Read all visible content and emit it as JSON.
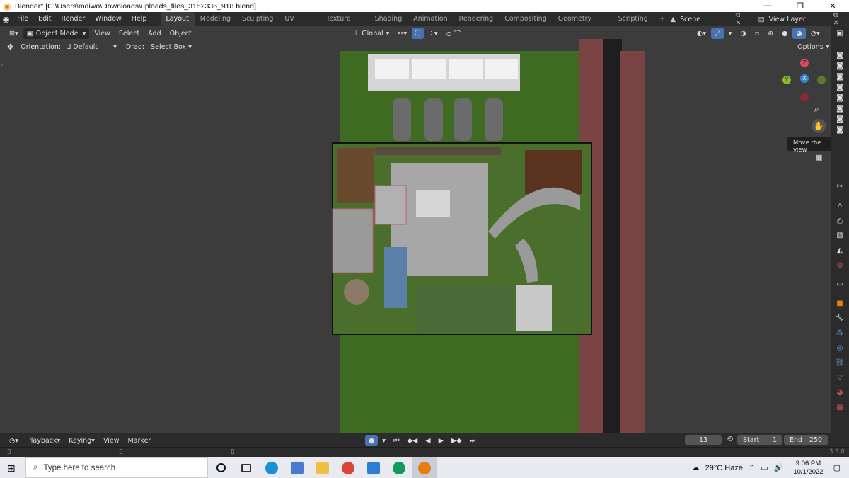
{
  "window": {
    "title": "Blender* [C:\\Users\\mdiwo\\Downloads\\uploads_files_3152336_918.blend]",
    "minimize": "—",
    "maximize": "❐",
    "close": "✕"
  },
  "menu": [
    "File",
    "Edit",
    "Render",
    "Window",
    "Help"
  ],
  "workspaces": [
    "Layout",
    "Modeling",
    "Sculpting",
    "UV Editing",
    "Texture Paint",
    "Shading",
    "Animation",
    "Rendering",
    "Compositing",
    "Geometry Nodes",
    "Scripting"
  ],
  "scene": {
    "label": "Scene",
    "view_layer": "View Layer"
  },
  "viewport_header": {
    "mode": "Object Mode",
    "menus": [
      "View",
      "Select",
      "Add",
      "Object"
    ],
    "transform": "Global"
  },
  "tool_header": {
    "orientation_label": "Orientation:",
    "orientation_value": "Default",
    "drag_label": "Drag:",
    "drag_value": "Select Box",
    "options": "Options"
  },
  "gizmo": {
    "x": "X",
    "y": "Y",
    "z": "Z"
  },
  "tooltip": "Move the view",
  "timeline": {
    "menus": [
      "Playback",
      "Keying",
      "View",
      "Marker"
    ],
    "current_frame": "13",
    "start_label": "Start",
    "start_value": "1",
    "end_label": "End",
    "end_value": "250",
    "version": "3.3.0"
  },
  "taskbar": {
    "search_placeholder": "Type here to search",
    "weather": "29°C  Haze",
    "time": "9:06 PM",
    "date": "10/1/2022"
  },
  "colors": {
    "accent": "#4772b3",
    "grass": "#3e6b22",
    "brick": "#7a4444",
    "blender_orange": "#e87d0d"
  }
}
